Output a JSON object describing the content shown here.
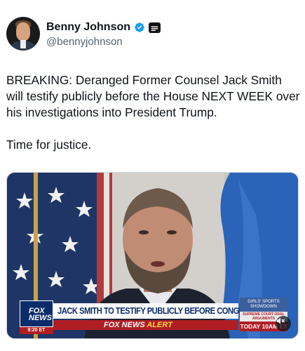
{
  "author": {
    "display_name": "Benny Johnson",
    "handle": "@bennyjohnson",
    "verified_color": "#1d9bf0",
    "avatar_icon": "profile-photo"
  },
  "tweet": {
    "paragraphs": [
      "BREAKING: Deranged Former Counsel Jack Smith will testify publicly before the House NEXT WEEK over his investigations into President Trump.",
      "Time for justice."
    ]
  },
  "media": {
    "type": "video",
    "broadcast": {
      "network_logo": "FOX NEWS",
      "time": "9:20 ET",
      "headline": "JACK SMITH TO TESTIFY PUBLICLY BEFORE CONGRESS",
      "alert_prefix": "FOX NEWS",
      "alert_suffix": "ALERT",
      "side_top": "GIRLS' SPORTS SHOWDOWN",
      "side_mid": "SUPREME COURT ORAL ARGUMENTS",
      "side_bottom": "TODAY 10AM ET"
    },
    "mute_icon": "speaker-muted-icon"
  },
  "colors": {
    "fox_blue": "#0b2c6b",
    "fox_red": "#b01e23",
    "alert_yellow": "#f6d44a",
    "text_primary": "#0f1419",
    "text_secondary": "#536471"
  }
}
